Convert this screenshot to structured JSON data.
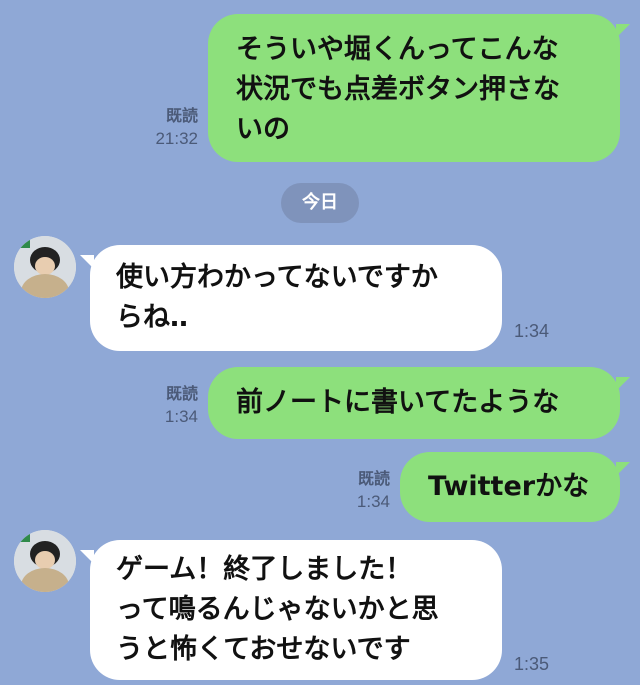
{
  "chat": {
    "messages": [
      {
        "side": "out",
        "text": "そういや堀くんってこんな\n状況でも点差ボタン押さな\nいの",
        "read": "既読",
        "time": "21:32"
      },
      {
        "side": "in",
        "text": "使い方わかってないですか\nらね‥",
        "time": "1:34"
      },
      {
        "side": "out",
        "text": "前ノートに書いてたような",
        "read": "既読",
        "time": "1:34"
      },
      {
        "side": "out",
        "text": "Twitterかな",
        "read": "既読",
        "time": "1:34"
      },
      {
        "side": "in",
        "text": "ゲーム！終了しました！\nって鳴るんじゃないかと思\nうと怖くておせないです",
        "time": "1:35"
      }
    ],
    "date_separator": "今日"
  },
  "colors": {
    "background": "#8fa8d6",
    "outgoing_bubble": "#8de07c",
    "incoming_bubble": "#ffffff"
  }
}
